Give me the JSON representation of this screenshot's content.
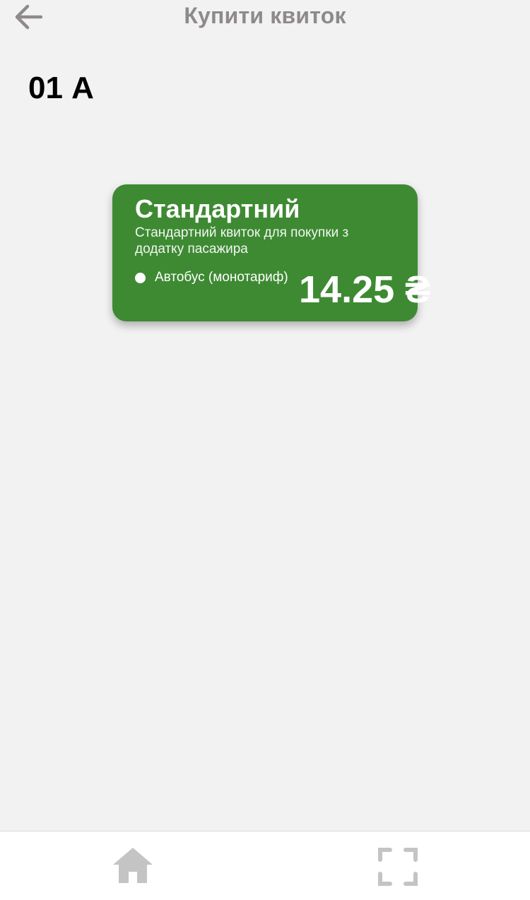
{
  "header": {
    "title": "Купити квиток",
    "back_icon": "arrow-left-icon"
  },
  "route": {
    "number": "01 А"
  },
  "ticket": {
    "title": "Стандартний",
    "description": "Стандартний квиток для покупки з додатку пасажира",
    "feature": "Автобус (монотариф)",
    "price": "14.25 ₴",
    "color": "#3e8a33"
  },
  "bottom_nav": {
    "items": [
      {
        "icon": "home-icon"
      },
      {
        "icon": "scan-icon"
      }
    ],
    "icon_color": "#c4c4c4"
  }
}
